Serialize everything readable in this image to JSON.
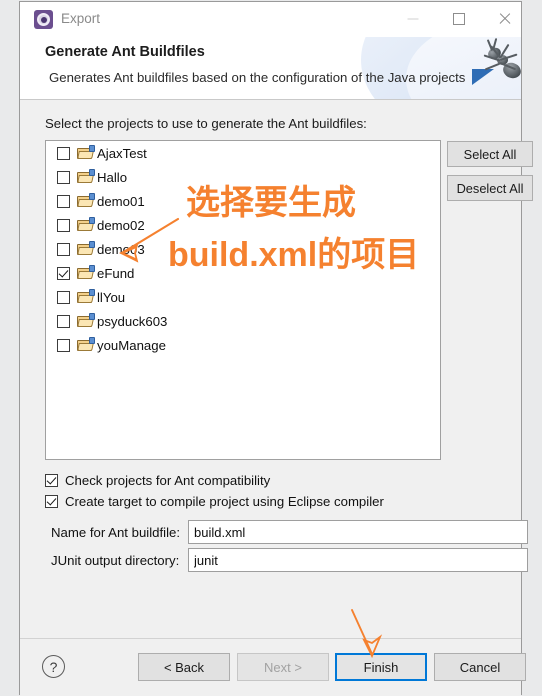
{
  "window": {
    "title": "Export",
    "icon": "eclipse-export-icon",
    "controls": {
      "minimize": "minimize-icon",
      "maximize": "maximize-icon",
      "close": "close-icon"
    }
  },
  "banner": {
    "heading": "Generate Ant Buildfiles",
    "subtext": "Generates Ant buildfiles based on the configuration of the Java projects",
    "graphic": "ant-icon"
  },
  "main": {
    "prompt": "Select the projects to use to generate the Ant buildfiles:",
    "projects": [
      {
        "name": "AjaxTest",
        "checked": false
      },
      {
        "name": "Hallo",
        "checked": false
      },
      {
        "name": "demo01",
        "checked": false
      },
      {
        "name": "demo02",
        "checked": false
      },
      {
        "name": "demo03",
        "checked": false
      },
      {
        "name": "eFund",
        "checked": true
      },
      {
        "name": "llYou",
        "checked": false
      },
      {
        "name": "psyduck603",
        "checked": false
      },
      {
        "name": "youManage",
        "checked": false
      }
    ],
    "side_buttons": {
      "select_all": "Select All",
      "deselect_all": "Deselect All"
    },
    "options": [
      {
        "label": "Check projects for Ant compatibility",
        "checked": true
      },
      {
        "label": "Create target to compile project using Eclipse compiler",
        "checked": true
      }
    ],
    "fields": [
      {
        "label": "Name for Ant buildfile:",
        "value": "build.xml",
        "placeholder": "build.xml"
      },
      {
        "label": "JUnit output directory:",
        "value": "junit",
        "placeholder": "junit"
      }
    ]
  },
  "footer": {
    "help": "?",
    "back": "< Back",
    "next": "Next >",
    "finish": "Finish",
    "cancel": "Cancel"
  },
  "annotations": {
    "line1": "选择要生成",
    "line2": "build.xml的项目",
    "color": "#f5812f",
    "arrow_to_project": "arrow pointing at eFund",
    "arrow_to_finish": "arrow pointing at Finish"
  },
  "colors": {
    "accent": "#f5812f",
    "focus_border": "#0078d7",
    "dialog_bg": "#f0f0f0",
    "list_bg": "#ffffff"
  }
}
